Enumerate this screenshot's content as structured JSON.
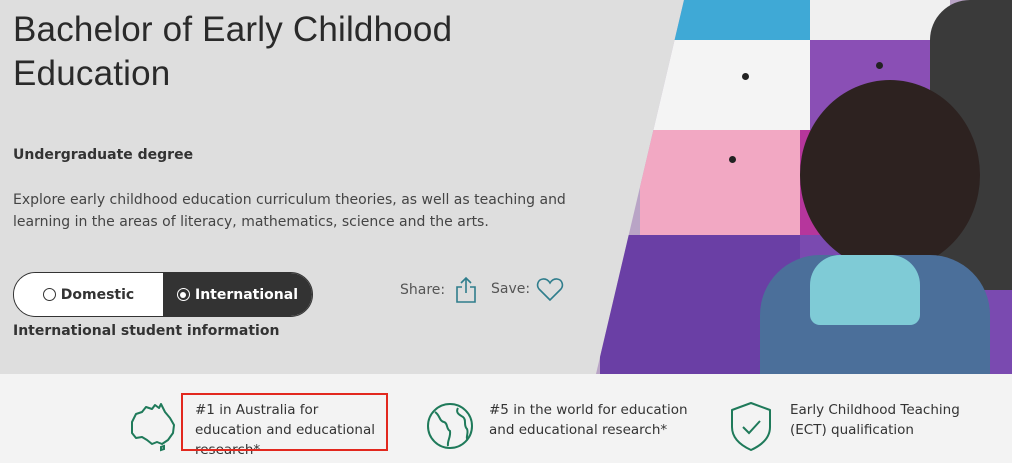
{
  "hero": {
    "title": "Bachelor of Early Childhood Education",
    "subtitle": "Undergraduate degree",
    "description": "Explore early childhood education curriculum theories, as well as teaching and learning in the areas of literacy, mathematics, science and the arts.",
    "toggle": {
      "domestic_label": "Domestic",
      "international_label": "International",
      "selected": "International"
    },
    "share_label": "Share:",
    "save_label": "Save:",
    "intl_info_label": "International student information"
  },
  "features": [
    {
      "icon": "australia-map-icon",
      "text": "#1 in Australia for education and educational research*"
    },
    {
      "icon": "globe-icon",
      "text": "#5 in the world for education and educational research*"
    },
    {
      "icon": "shield-check-icon",
      "text": "Early Childhood Teaching (ECT) qualification"
    }
  ],
  "colors": {
    "brand_green": "#1f7a5a",
    "toggle_active": "#333333",
    "highlight": "#e2281e"
  }
}
